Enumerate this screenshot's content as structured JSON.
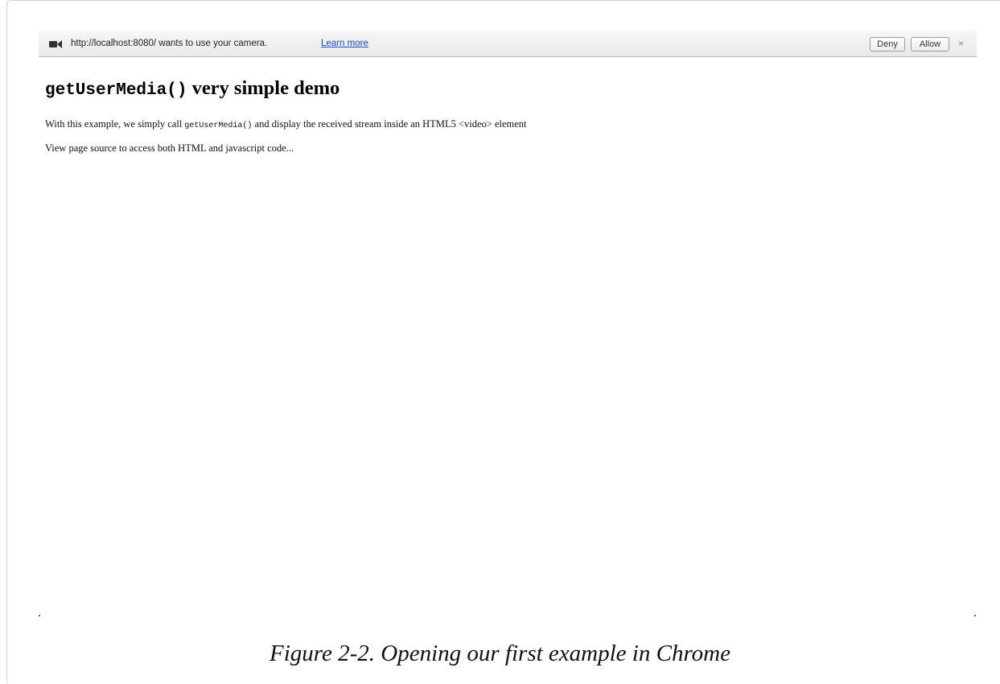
{
  "infobar": {
    "message": "http://localhost:8080/ wants to use your camera.",
    "learn_more": "Learn more",
    "deny_label": "Deny",
    "allow_label": "Allow",
    "close_label": "×",
    "icon": "camera-icon"
  },
  "page": {
    "title_code": "getUserMedia()",
    "title_text": " very simple demo",
    "p1_before": "With this example, we simply call ",
    "p1_code": "getUserMedia()",
    "p1_after": " and display the received stream inside an HTML5 <video> element",
    "p2": "View page source to access both HTML and javascript code..."
  },
  "caption": "Figure 2-2. Opening our first example in Chrome"
}
